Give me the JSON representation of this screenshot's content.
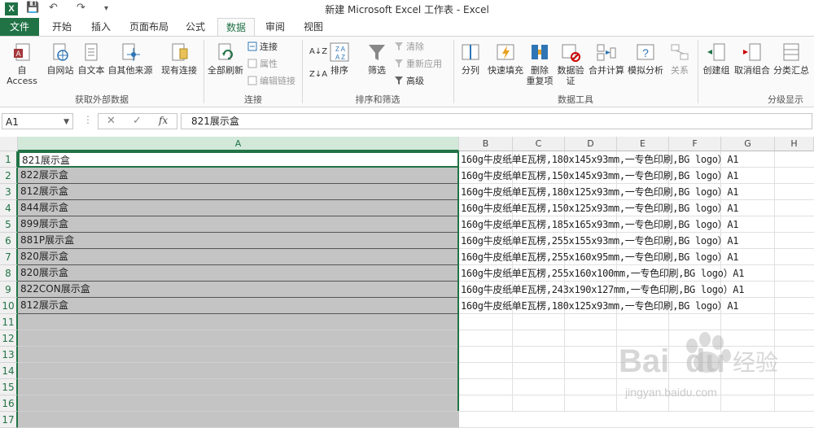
{
  "window": {
    "title": "新建 Microsoft Excel 工作表 - Excel",
    "app_icon": "X",
    "qat_save": "💾",
    "qat_undo": "↶",
    "qat_redo": "↷",
    "qat_more": "▾"
  },
  "tabs": [
    {
      "label": "文件"
    },
    {
      "label": "开始"
    },
    {
      "label": "插入"
    },
    {
      "label": "页面布局"
    },
    {
      "label": "公式"
    },
    {
      "label": "数据"
    },
    {
      "label": "审阅"
    },
    {
      "label": "视图"
    }
  ],
  "ribbon": {
    "get_external": {
      "label": "获取外部数据",
      "buttons": [
        "自 Access",
        "自网站",
        "自文本",
        "自其他来源",
        "现有连接"
      ]
    },
    "connections": {
      "label": "连接",
      "refresh_all": "全部刷新",
      "small": [
        "连接",
        "属性",
        "编辑链接"
      ]
    },
    "sort_filter": {
      "label": "排序和筛选",
      "sort": "排序",
      "filter": "筛选",
      "small": [
        "清除",
        "重新应用",
        "高级"
      ]
    },
    "data_tools": {
      "label": "数据工具",
      "buttons": [
        "分列",
        "快速填充",
        "删除\n重复项",
        "数据验\n证",
        "合并计算",
        "模拟分析",
        "关系"
      ]
    },
    "outline": {
      "label": "分级显示",
      "buttons": [
        "创建组",
        "取消组合",
        "分类汇总"
      ]
    }
  },
  "formula_bar": {
    "name_box": "A1",
    "cancel": "✕",
    "enter": "✓",
    "fx": "fx",
    "content": "821展示盒"
  },
  "columns": [
    "A",
    "B",
    "C",
    "D",
    "E",
    "F",
    "G",
    "H"
  ],
  "rows": [
    {
      "num": "1",
      "a": "821展示盒",
      "b": "160g牛皮纸单E瓦楞,180x145x93mm,一专色印刷,BG logo）A1"
    },
    {
      "num": "2",
      "a": "822展示盒",
      "b": "160g牛皮纸单E瓦楞,150x145x93mm,一专色印刷,BG logo）A1"
    },
    {
      "num": "3",
      "a": "812展示盒",
      "b": "160g牛皮纸单E瓦楞,180x125x93mm,一专色印刷,BG logo）A1"
    },
    {
      "num": "4",
      "a": "844展示盒",
      "b": "160g牛皮纸单E瓦楞,150x125x93mm,一专色印刷,BG logo）A1"
    },
    {
      "num": "5",
      "a": "899展示盒",
      "b": "160g牛皮纸单E瓦楞,185x165x93mm,一专色印刷,BG logo）A1"
    },
    {
      "num": "6",
      "a": "881P展示盒",
      "b": "160g牛皮纸单E瓦楞,255x155x93mm,一专色印刷,BG logo）A1"
    },
    {
      "num": "7",
      "a": "820展示盒",
      "b": "160g牛皮纸单E瓦楞,255x160x95mm,一专色印刷,BG logo）A1"
    },
    {
      "num": "8",
      "a": "820展示盒",
      "b": "160g牛皮纸单E瓦楞,255x160x100mm,一专色印刷,BG logo）A1"
    },
    {
      "num": "9",
      "a": "822CON展示盒",
      "b": "160g牛皮纸单E瓦楞,243x190x127mm,一专色印刷,BG logo）A1"
    },
    {
      "num": "10",
      "a": "812展示盒",
      "b": "160g牛皮纸单E瓦楞,180x125x93mm,一专色印刷,BG logo）A1"
    },
    {
      "num": "11",
      "a": "",
      "b": ""
    },
    {
      "num": "12",
      "a": "",
      "b": ""
    },
    {
      "num": "13",
      "a": "",
      "b": ""
    },
    {
      "num": "14",
      "a": "",
      "b": ""
    },
    {
      "num": "15",
      "a": "",
      "b": ""
    },
    {
      "num": "16",
      "a": "",
      "b": ""
    },
    {
      "num": "17",
      "a": "",
      "b": ""
    }
  ],
  "watermark": {
    "brand": "Bai",
    "brand2": "经验",
    "url": "jingyan.baidu.com"
  },
  "colors": {
    "excel_green": "#217346",
    "selection_gray": "#c4c4c4"
  }
}
